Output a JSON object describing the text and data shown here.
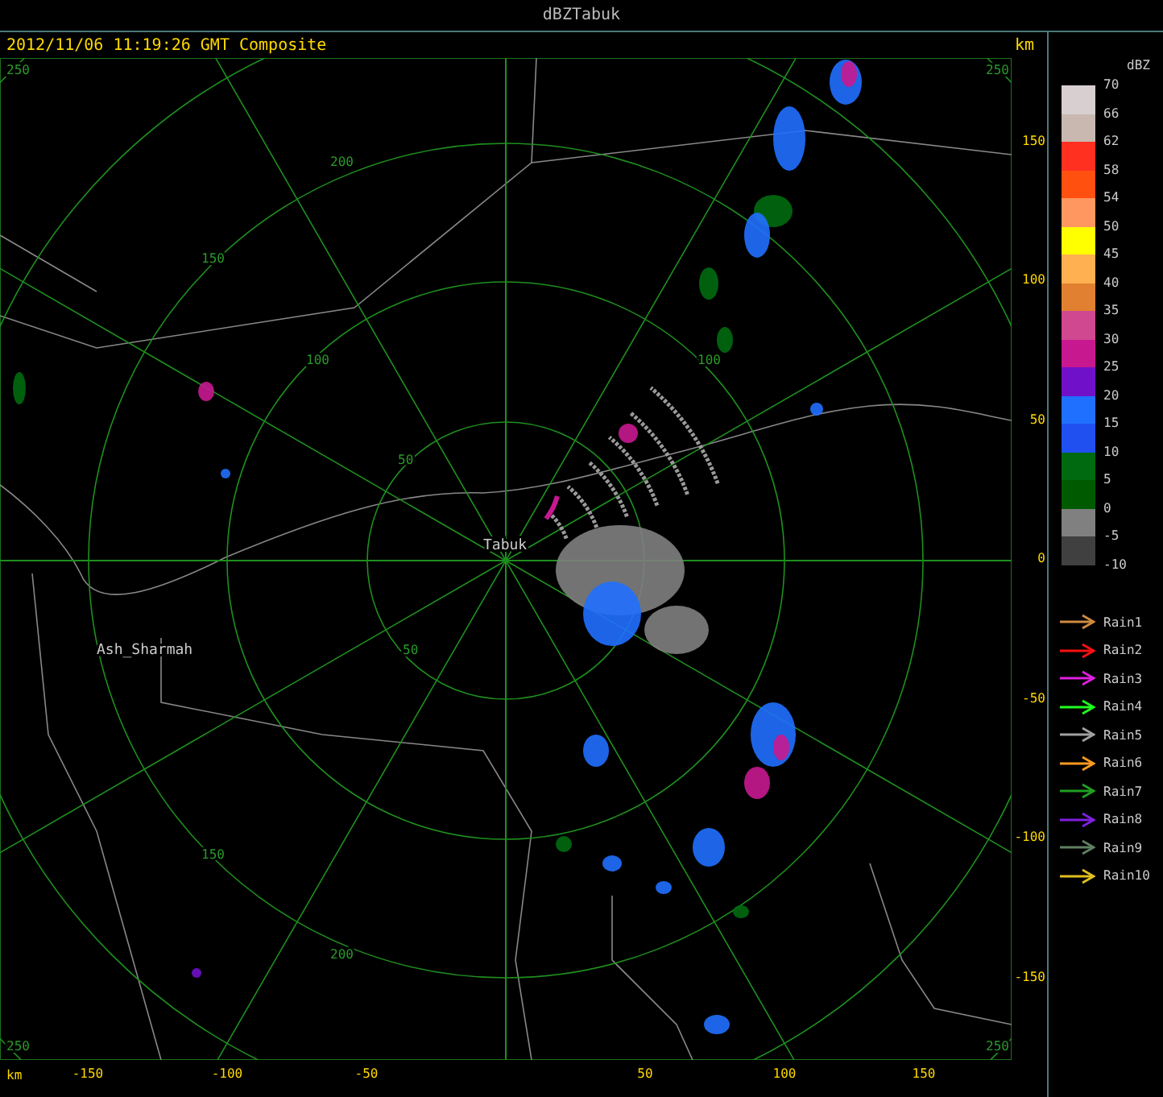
{
  "window": {
    "title": "dBZTabuk"
  },
  "plot": {
    "timestamp": "2012/11/06 11:19:26 GMT Composite",
    "unit_top": "km",
    "unit_bottom": "km",
    "y_ticks": [
      "150",
      "100",
      "50",
      "0",
      "-50",
      "-100",
      "-150"
    ],
    "x_ticks": [
      "-150",
      "-100",
      "-50",
      "50",
      "100",
      "150"
    ],
    "map_labels": [
      {
        "kind": "place",
        "text": "Tabuk"
      },
      {
        "kind": "place",
        "text": "Ash_Sharmah"
      },
      {
        "kind": "range",
        "text": "250"
      },
      {
        "kind": "range",
        "text": "250"
      },
      {
        "kind": "range",
        "text": "200"
      },
      {
        "kind": "range",
        "text": "150"
      },
      {
        "kind": "range",
        "text": "100"
      },
      {
        "kind": "range",
        "text": "50"
      },
      {
        "kind": "range",
        "text": "100"
      },
      {
        "kind": "range",
        "text": "50"
      },
      {
        "kind": "range",
        "text": "150"
      },
      {
        "kind": "range",
        "text": "200"
      },
      {
        "kind": "range",
        "text": "250"
      },
      {
        "kind": "range",
        "text": "250"
      }
    ]
  },
  "legend": {
    "unit": "dBZ",
    "scale": [
      {
        "label": "70",
        "color": "#d8d0d0"
      },
      {
        "label": "66",
        "color": "#c8b8b0"
      },
      {
        "label": "62",
        "color": "#ff3020"
      },
      {
        "label": "58",
        "color": "#ff5010"
      },
      {
        "label": "54",
        "color": "#ff9860"
      },
      {
        "label": "50",
        "color": "#ffff00"
      },
      {
        "label": "45",
        "color": "#ffb050"
      },
      {
        "label": "40",
        "color": "#e08030"
      },
      {
        "label": "35",
        "color": "#d04890"
      },
      {
        "label": "30",
        "color": "#c81890"
      },
      {
        "label": "25",
        "color": "#7010c8"
      },
      {
        "label": "20",
        "color": "#2070ff"
      },
      {
        "label": "15",
        "color": "#2050f0"
      },
      {
        "label": "10",
        "color": "#006a10"
      },
      {
        "label": "5",
        "color": "#005a00"
      },
      {
        "label": "0",
        "color": "#808080"
      },
      {
        "label": "-5",
        "color": "#404040"
      }
    ],
    "bottom_label": "-10",
    "tracks": [
      {
        "label": "Rain1",
        "color": "#d08a40"
      },
      {
        "label": "Rain2",
        "color": "#ff1010"
      },
      {
        "label": "Rain3",
        "color": "#e020e0"
      },
      {
        "label": "Rain4",
        "color": "#20ff20"
      },
      {
        "label": "Rain5",
        "color": "#a0a0a0"
      },
      {
        "label": "Rain6",
        "color": "#ff9a20"
      },
      {
        "label": "Rain7",
        "color": "#20a020"
      },
      {
        "label": "Rain8",
        "color": "#8020e0"
      },
      {
        "label": "Rain9",
        "color": "#608060"
      },
      {
        "label": "Rain10",
        "color": "#e0c020"
      }
    ]
  }
}
